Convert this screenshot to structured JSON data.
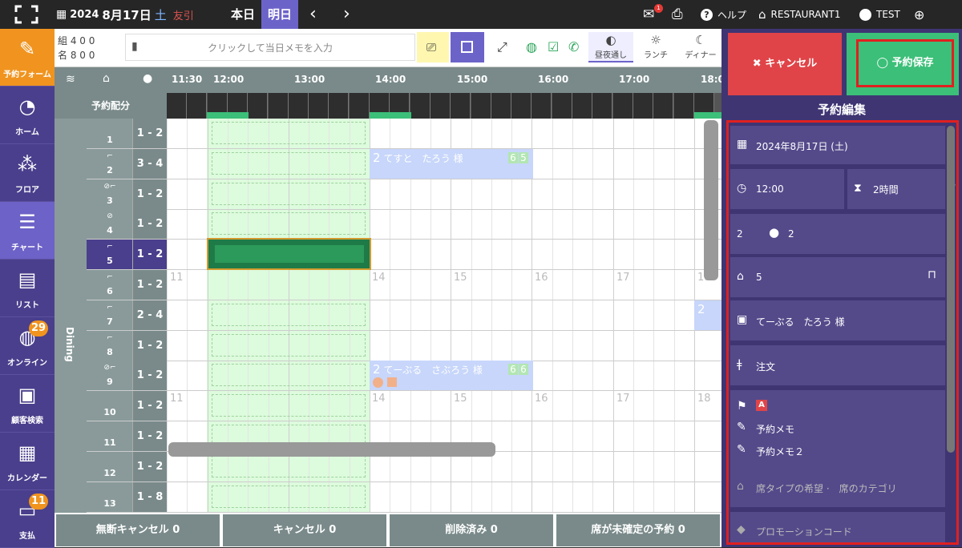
{
  "topbar": {
    "year": "2024",
    "date": "8月17日",
    "weekday": "土",
    "rokuyo": "友引",
    "today_label": "本日",
    "tomorrow_label": "明日",
    "mail_badge": "1",
    "help_label": "ヘルプ",
    "restaurant_label": "RESTAURANT1",
    "user_label": "TEST"
  },
  "sidebar": {
    "items": [
      {
        "label": "予約フォーム",
        "icon": "edit-icon"
      },
      {
        "label": "ホーム",
        "icon": "dashboard-icon"
      },
      {
        "label": "フロア",
        "icon": "floor-icon"
      },
      {
        "label": "チャート",
        "icon": "chart-icon"
      },
      {
        "label": "リスト",
        "icon": "list-icon"
      },
      {
        "label": "オンライン",
        "icon": "globe-icon",
        "badge": "29"
      },
      {
        "label": "顧客検索",
        "icon": "customer-icon"
      },
      {
        "label": "カレンダー",
        "icon": "calendar-icon"
      },
      {
        "label": "支払",
        "icon": "payment-icon",
        "badge": "11"
      }
    ]
  },
  "toolbar": {
    "count_line1": "組 4  0  0",
    "count_line2": "名 8    0    0",
    "memo_placeholder": "クリックして当日メモを入力",
    "views": [
      {
        "label": "昼夜通し",
        "icon": "day-night-icon"
      },
      {
        "label": "ランチ",
        "icon": "sun-icon"
      },
      {
        "label": "ディナー",
        "icon": "moon-icon"
      }
    ]
  },
  "chart": {
    "times": [
      "11:30",
      "12:00",
      "13:00",
      "14:00",
      "15:00",
      "16:00",
      "17:00",
      "18:0"
    ],
    "alloc_label": "予約配分",
    "area_label": "Dining",
    "hour_marks": [
      "11",
      "14",
      "15",
      "16",
      "17",
      "18"
    ],
    "tables": [
      {
        "no": "1",
        "cap": "1 - 2"
      },
      {
        "no": "2",
        "cap": "3 - 4"
      },
      {
        "no": "3",
        "cap": "1 - 2"
      },
      {
        "no": "4",
        "cap": "1 - 2"
      },
      {
        "no": "5",
        "cap": "1 - 2"
      },
      {
        "no": "6",
        "cap": "1 - 2"
      },
      {
        "no": "7",
        "cap": "2 - 4"
      },
      {
        "no": "8",
        "cap": "1 - 2"
      },
      {
        "no": "9",
        "cap": "1 - 2"
      },
      {
        "no": "10",
        "cap": "1 - 2"
      },
      {
        "no": "11",
        "cap": "1 - 2"
      },
      {
        "no": "12",
        "cap": "1 - 2"
      },
      {
        "no": "13",
        "cap": "1 - 8"
      }
    ],
    "reservations": [
      {
        "count": "2",
        "name": "てすと　たろう 様",
        "badge1": "6",
        "badge2": "5"
      },
      {
        "count": "2",
        "name": "てーぶる　さぶろう 様",
        "badge1": "6",
        "badge2": "6"
      },
      {
        "count": "2"
      }
    ]
  },
  "footer": {
    "noshow": "無断キャンセル 0",
    "cancel": "キャンセル 0",
    "deleted": "削除済み 0",
    "unassigned": "席が未確定の予約 0"
  },
  "panel": {
    "cancel_label": "キャンセル",
    "save_label": "予約保存",
    "title": "予約編集",
    "date": "2024年8月17日 (土)",
    "time": "12:00",
    "duration": "2時間",
    "party_total": "2",
    "party_adults": "2",
    "table": "5",
    "customer": "てーぶる　たろう 様",
    "order": "注文",
    "tag": "A",
    "memo1": "予約メモ",
    "memo2": "予約メモ２",
    "seat_pref": "席タイプの希望 ·　席のカテゴリ",
    "promo": "プロモーションコード"
  }
}
